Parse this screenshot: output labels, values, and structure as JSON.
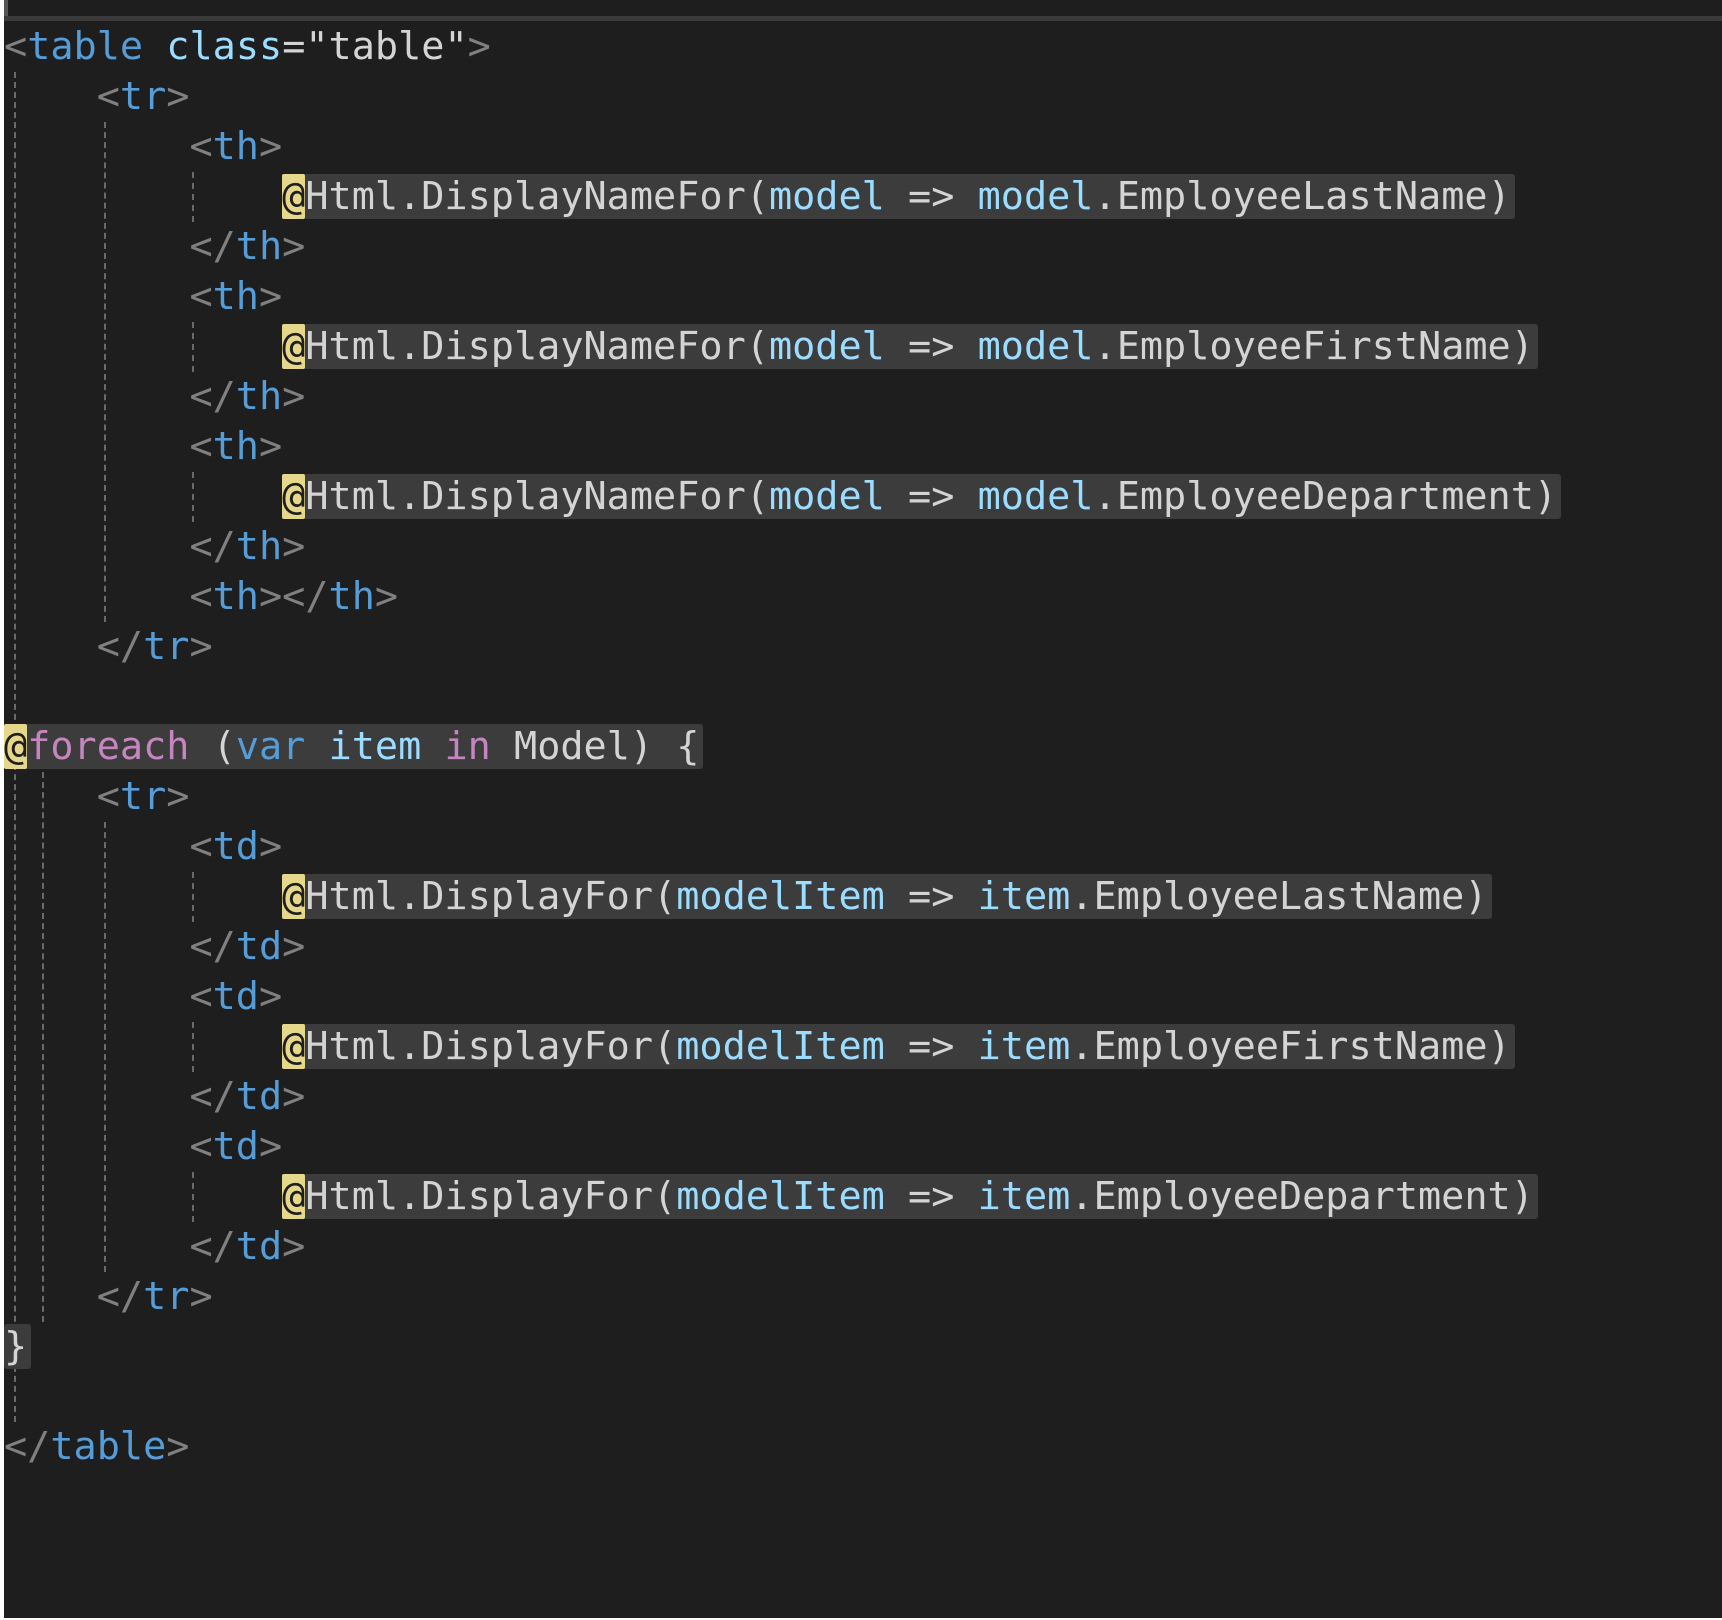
{
  "editor": {
    "colors": {
      "background": "#1e1e1e",
      "tag": "#569cd6",
      "attribute": "#9cdcfe",
      "punctuation": "#808080",
      "razor_transition": "#e6d88a",
      "keyword": "#c586c0",
      "razor_block_highlight": "#3c3c3c"
    },
    "code_lines": [
      "<table class=\"table\">",
      "    <tr>",
      "        <th>",
      "            @Html.DisplayNameFor(model => model.EmployeeLastName)",
      "        </th>",
      "        <th>",
      "            @Html.DisplayNameFor(model => model.EmployeeFirstName)",
      "        </th>",
      "        <th>",
      "            @Html.DisplayNameFor(model => model.EmployeeDepartment)",
      "        </th>",
      "        <th></th>",
      "    </tr>",
      "",
      "@foreach (var item in Model) {",
      "    <tr>",
      "        <td>",
      "            @Html.DisplayFor(modelItem => item.EmployeeLastName)",
      "        </td>",
      "        <td>",
      "            @Html.DisplayFor(modelItem => item.EmployeeFirstName)",
      "        </td>",
      "        <td>",
      "            @Html.DisplayFor(modelItem => item.EmployeeDepartment)",
      "        </td>",
      "    </tr>",
      "}",
      "",
      "</table>"
    ]
  }
}
